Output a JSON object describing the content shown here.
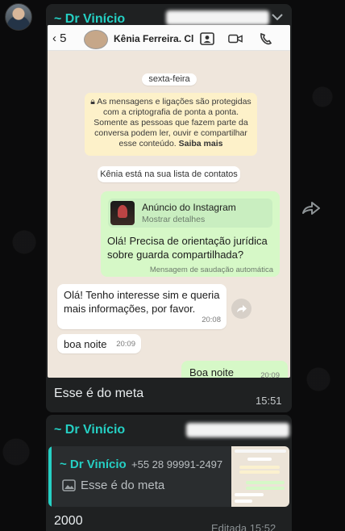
{
  "message1": {
    "sender": "~ Dr Vinício",
    "caption": "Esse é do meta",
    "time": "15:51"
  },
  "screenshot": {
    "header": {
      "back_count": "5",
      "contact_name": "Kênia Ferreira. Cl..."
    },
    "day_label": "sexta-feira",
    "encryption_notice": "As mensagens e ligações são protegidas com a criptografia de ponta a ponta. Somente as pessoas que fazem parte da conversa podem ler, ouvir e compartilhar esse conteúdo.",
    "encryption_link": "Saiba mais",
    "contact_notice": "Kênia está na sua lista de contatos",
    "ad": {
      "title": "Anúncio do Instagram",
      "subtitle": "Mostrar detalhes",
      "text": "Olá! Precisa de orientação jurídica sobre guarda compartilhada?",
      "meta": "Mensagem de saudação automática"
    },
    "incoming": [
      {
        "text": "Olá! Tenho interesse sim e queria mais informações, por favor.",
        "time": "20:08"
      },
      {
        "text": "boa noite",
        "time": "20:09"
      }
    ],
    "outgoing": {
      "text": "Boa noite",
      "time": "20:09"
    }
  },
  "message2": {
    "sender": "~ Dr Vinício",
    "quote": {
      "name": "~ Dr Vinício",
      "phone": "+55 28 99991-2497",
      "text": "Esse é do meta"
    },
    "text": "2000",
    "time": "Editada 15:52"
  },
  "icons": [
    "avatar",
    "chevron-down-icon",
    "back-arrow-icon",
    "contact-card-icon",
    "video-call-icon",
    "phone-icon",
    "lock-icon",
    "forward-icon",
    "image-icon"
  ],
  "colors": {
    "accent": "#25d0c4",
    "bubble": "#1f2122",
    "background": "#0b0b0c",
    "outgoing_bubble": "#d6f8c7",
    "encryption_bg": "#fdf1c9"
  }
}
